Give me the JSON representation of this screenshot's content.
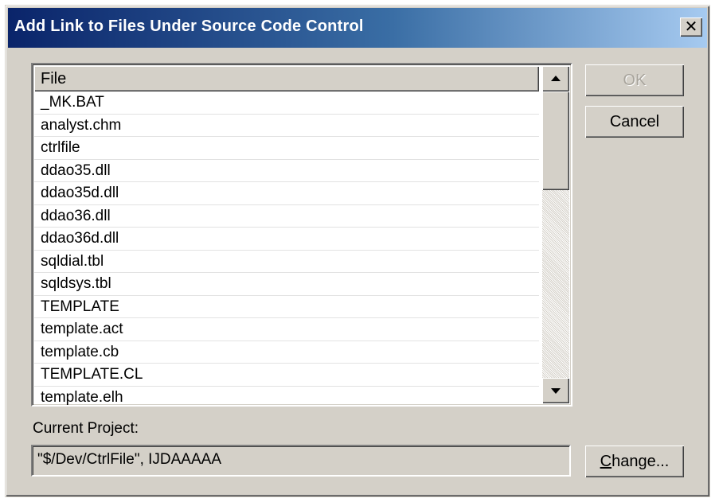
{
  "window": {
    "title": "Add Link to Files Under Source Code Control",
    "close_glyph": "✕"
  },
  "file_list": {
    "column_header": "File",
    "items": [
      "_MK.BAT",
      "analyst.chm",
      "ctrlfile",
      "ddao35.dll",
      "ddao35d.dll",
      "ddao36.dll",
      "ddao36d.dll",
      "sqldial.tbl",
      "sqldsys.tbl",
      "TEMPLATE",
      "template.act",
      "template.cb",
      "TEMPLATE.CL",
      "template.elh"
    ]
  },
  "buttons": {
    "ok_label": "OK",
    "ok_enabled": false,
    "cancel_label": "Cancel",
    "change_label": "Change..."
  },
  "project": {
    "label": "Current Project:",
    "value": "\"$/Dev/CtrlFile\", IJDAAAAA"
  },
  "icons": {
    "close": "close-icon",
    "scroll_up": "scroll-up-arrow-icon",
    "scroll_down": "scroll-down-arrow-icon"
  },
  "colors": {
    "dialog_face": "#d4d0c8",
    "title_start": "#0a246a",
    "title_end": "#a6caf0",
    "disabled_text": "#a8a49c"
  }
}
